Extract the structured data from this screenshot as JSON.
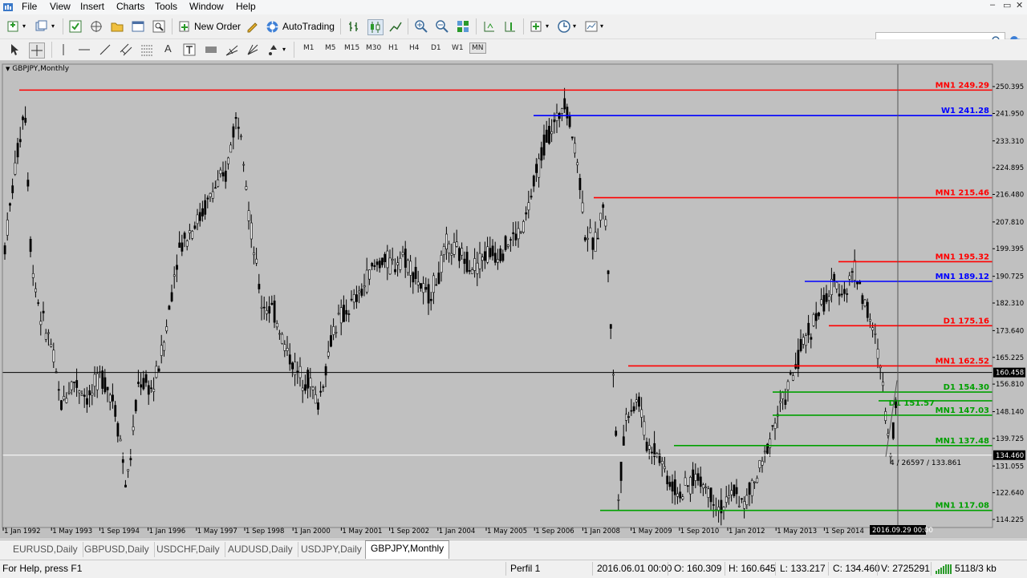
{
  "menu": [
    "File",
    "View",
    "Insert",
    "Charts",
    "Tools",
    "Window",
    "Help"
  ],
  "toolbar": {
    "new_order": "New Order",
    "autotrading": "AutoTrading",
    "timeframes": [
      "M1",
      "M5",
      "M15",
      "M30",
      "H1",
      "H4",
      "D1",
      "W1",
      "MN"
    ],
    "active_timeframe": "MN"
  },
  "chart": {
    "title": "GBPJPY,Monthly",
    "colors": {
      "background": "#c0c0c0",
      "candle": "#000000",
      "red_level": "#ff0000",
      "blue_level": "#0000ff",
      "green_level": "#00a000",
      "label_red": "#ff0000",
      "label_blue": "#0000ff",
      "label_green": "#00a000"
    },
    "price_axis": [
      "250.395",
      "241.950",
      "233.310",
      "224.895",
      "216.480",
      "207.810",
      "199.395",
      "190.725",
      "182.310",
      "173.640",
      "165.225",
      "156.810",
      "148.140",
      "139.725",
      "131.055",
      "122.640",
      "114.225"
    ],
    "current_price": "160.458",
    "cursor_price": "134.460",
    "time_axis": [
      "1 Jan 1992",
      "1 May 1993",
      "1 Sep 1994",
      "1 Jan 1996",
      "1 May 1997",
      "1 Sep 1998",
      "1 Jan 2000",
      "1 May 2001",
      "1 Sep 2002",
      "1 Jan 2004",
      "1 May 2005",
      "1 Sep 2006",
      "1 Jan 2008",
      "1 May 2009",
      "1 Sep 2010",
      "1 Jan 2012",
      "1 May 2013",
      "1 Sep 2014"
    ],
    "cursor_time": "2016.09.29 00:00",
    "crosshair_info": "4 / 26597 / 133.861",
    "levels": [
      {
        "label": "MN1 249.29",
        "color": "red",
        "price": 249.29
      },
      {
        "label": "W1 241.28",
        "color": "blue",
        "price": 241.28
      },
      {
        "label": "MN1 215.46",
        "color": "red",
        "price": 215.46
      },
      {
        "label": "MN1 195.32",
        "color": "red",
        "price": 195.32
      },
      {
        "label": "MN1 189.12",
        "color": "blue",
        "price": 189.12
      },
      {
        "label": "D1 175.16",
        "color": "red",
        "price": 175.16
      },
      {
        "label": "MN1 162.52",
        "color": "red",
        "price": 162.52
      },
      {
        "label": "D1 154.30",
        "color": "green",
        "price": 154.3
      },
      {
        "label": "D1 151.57",
        "color": "green",
        "price": 151.57
      },
      {
        "label": "MN1 147.03",
        "color": "green",
        "price": 147.03
      },
      {
        "label": "MN1 137.48",
        "color": "green",
        "price": 137.48
      },
      {
        "label": "MN1 117.08",
        "color": "green",
        "price": 117.08
      }
    ]
  },
  "tabs": [
    "EURUSD,Daily",
    "GBPUSD,Daily",
    "USDCHF,Daily",
    "AUDUSD,Daily",
    "USDJPY,Daily",
    "GBPJPY,Monthly"
  ],
  "active_tab": "GBPJPY,Monthly",
  "status": {
    "help": "For Help, press F1",
    "profile": "Perfil 1",
    "datetime": "2016.06.01 00:00",
    "open": "O: 160.309",
    "high": "H: 160.645",
    "low": "L: 133.217",
    "close": "C: 134.460",
    "volume": "V: 2725291",
    "traffic": "5118/3 kb"
  }
}
